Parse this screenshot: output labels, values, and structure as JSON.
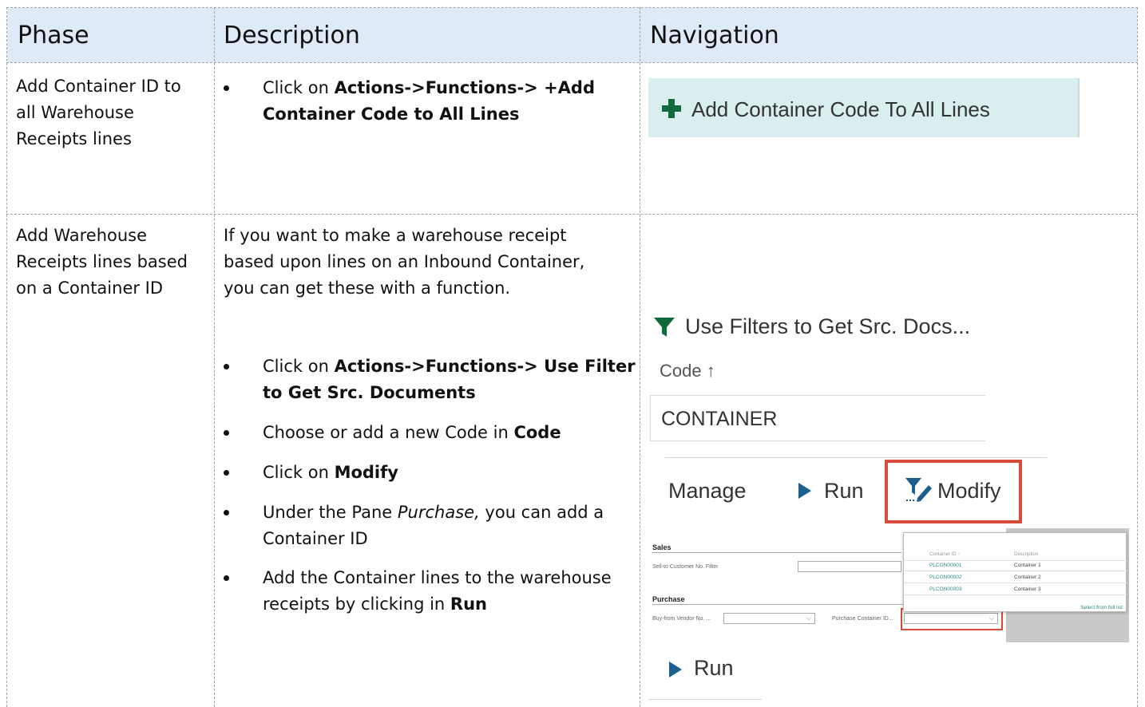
{
  "table": {
    "headers": [
      "Phase",
      "Description",
      "Navigation"
    ]
  },
  "row1": {
    "phase": [
      "Add Container ID to",
      "all Warehouse",
      "Receipts lines"
    ],
    "bullet": {
      "line1_pre": "Click on ",
      "line1_bold": "Actions->Functions-> +Add",
      "line2_bold": "Container Code to All Lines"
    },
    "nav": {
      "action_label": "Add Container Code To All Lines",
      "icon": "plus-icon",
      "icon_color": "#0f6a3c"
    }
  },
  "row2": {
    "phase": [
      "Add Warehouse",
      "Receipts lines based",
      "on a Container ID"
    ],
    "intro": [
      "If you want to make a warehouse receipt",
      "based upon lines on an Inbound Container,",
      "you can get these with a function."
    ],
    "bullets": [
      {
        "pre": "Click on ",
        "bold": "Actions->Functions-> Use Filter",
        "line2_bold": "to Get Src. Documents"
      },
      {
        "pre": "Choose or add a new Code in ",
        "bold": "Code"
      },
      {
        "pre": "Click on ",
        "bold": "Modify"
      },
      {
        "pre": "Under the Pane ",
        "italic": "Purchase,",
        "post": " you can add a",
        "line2": "Container ID"
      },
      {
        "pre": "Add the Container lines to the warehouse",
        "line2_pre": "receipts by clicking in ",
        "line2_bold": "Run"
      }
    ],
    "nav": {
      "filter_action": "Use Filters to Get Src. Docs...",
      "filter_icon": "filter-icon",
      "code_header": "Code ↑",
      "code_value": "CONTAINER",
      "actions": [
        "Manage",
        "Run",
        "Modify"
      ],
      "modify_icon": "edit-filter-icon",
      "highlight_color": "#d94a3a",
      "filter_page": {
        "section_sales": "Sales",
        "field_sales": "Sell-to Customer No. Filter",
        "section_purchase": "Purchase",
        "field_vendor": "Buy-from Vendor No. ...",
        "field_container": "Purchase Container ID...",
        "lookup_headers": [
          "Container ID ↑",
          "Description"
        ],
        "lookup_rows": [
          {
            "id": "PLCON00001",
            "desc": "Container 1"
          },
          {
            "id": "PLCON00002",
            "desc": "Container 2"
          },
          {
            "id": "PLCON00003",
            "desc": "Container 3"
          }
        ],
        "select_link": "Select from full list"
      },
      "run_label": "Run",
      "accent_color": "#1b5f8e"
    }
  }
}
